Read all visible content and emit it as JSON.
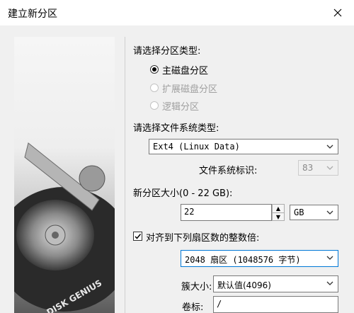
{
  "window": {
    "title": "建立新分区",
    "close_icon": "×"
  },
  "partition_type": {
    "label": "请选择分区类型:",
    "options": [
      {
        "label": "主磁盘分区",
        "selected": true,
        "enabled": true
      },
      {
        "label": "扩展磁盘分区",
        "selected": false,
        "enabled": false
      },
      {
        "label": "逻辑分区",
        "selected": false,
        "enabled": false
      }
    ]
  },
  "filesystem": {
    "label": "请选择文件系统类型:",
    "value": "Ext4 (Linux Data)",
    "id_label": "文件系统标识:",
    "id_value": "83"
  },
  "size": {
    "label": "新分区大小(0 - 22 GB):",
    "value": "22",
    "unit": "GB"
  },
  "align": {
    "checked": true,
    "label": "对齐到下列扇区数的整数倍:",
    "value": "2048 扇区 (1048576 字节)"
  },
  "cluster": {
    "label": "簇大小:",
    "value": "默认值(4096)"
  },
  "volume": {
    "label": "卷标:",
    "value": "/"
  },
  "side_image": {
    "logo_text": "DISK GENIUS"
  },
  "colors": {
    "accent": "#0078d7",
    "disabled": "#a0a0a0"
  }
}
